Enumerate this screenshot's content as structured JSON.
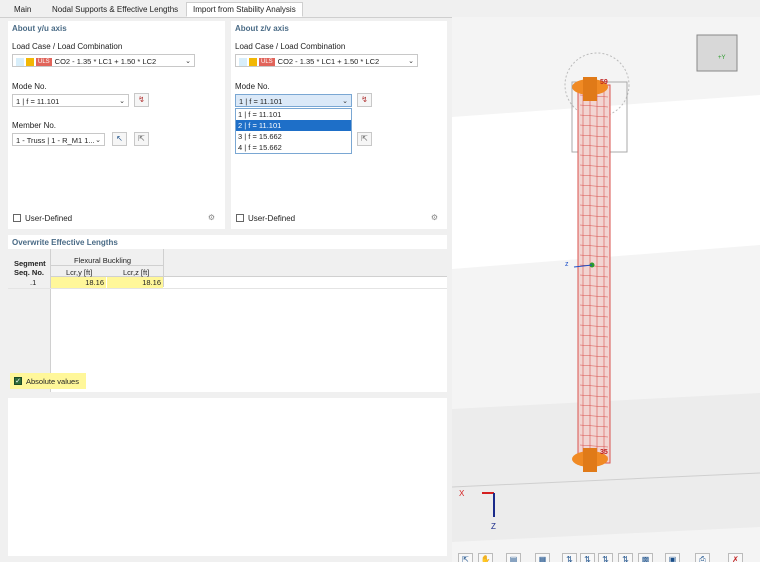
{
  "tabs": [
    "Main",
    "Nodal Supports & Effective Lengths",
    "Import from Stability Analysis"
  ],
  "left_panel": {
    "title": "About y/u axis",
    "load_case_label": "Load Case / Load Combination",
    "load_case_tag": "ULS",
    "load_case_value": "CO2 - 1.35 * LC1 + 1.50 * LC2",
    "mode_label": "Mode No.",
    "mode_value": "1 | f = 11.101",
    "member_label": "Member No.",
    "member_value": "1 - Truss | 1 - R_M1 1...",
    "user_defined": "User-Defined"
  },
  "right_panel": {
    "title": "About z/v axis",
    "load_case_label": "Load Case / Load Combination",
    "load_case_tag": "ULS",
    "load_case_value": "CO2 - 1.35 * LC1 + 1.50 * LC2",
    "mode_label": "Mode No.",
    "mode_value": "1 | f = 11.101",
    "mode_options": [
      "1 | f = 11.101",
      "2 | f = 11.101",
      "3 | f = 15.662",
      "4 | f = 15.662"
    ],
    "mode_highlight": 1,
    "user_defined": "User-Defined"
  },
  "overwrite": {
    "title": "Overwrite Effective Lengths",
    "col_segment_1": "Segment",
    "col_segment_2": "Seq. No.",
    "group_header": "Flexural Buckling",
    "col_lcry": "Lcr,y [ft]",
    "col_lcrz": "Lcr,z [ft]",
    "rows": [
      {
        "seq": ".1",
        "lcry": "18.16",
        "lcrz": "18.16"
      }
    ],
    "absolute_values": "Absolute values"
  },
  "view": {
    "label_top": "59",
    "label_bottom": "35",
    "axis_x": "X",
    "axis_z": "Z",
    "axis_small_z": "z",
    "cube_label": "+Y"
  },
  "colors": {
    "accent": "#4a6b86",
    "member": "#d9534f",
    "support": "#f08a24",
    "highlight": "#fff79a"
  }
}
